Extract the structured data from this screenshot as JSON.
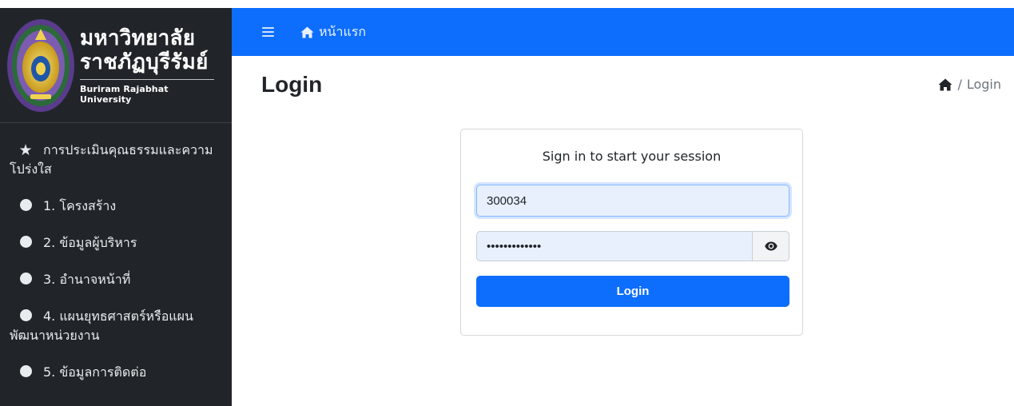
{
  "brand": {
    "name_line1": "มหาวิทยาลัย",
    "name_line2": "ราชภัฏบุรีรัมย์",
    "name_en": "Buriram Rajabhat University",
    "logo_icon": "university-seal"
  },
  "sidebar": {
    "items": [
      {
        "label": "การประเมินคุณธรรมและความโปร่งใส",
        "icon": "star-icon"
      },
      {
        "label": "1. โครงสร้าง",
        "icon": "circle-icon"
      },
      {
        "label": "2. ข้อมูลผู้บริหาร",
        "icon": "circle-icon"
      },
      {
        "label": "3. อำนาจหน้าที่",
        "icon": "circle-icon"
      },
      {
        "label": "4. แผนยุทธศาสตร์หรือแผนพัฒนาหน่วยงาน",
        "icon": "circle-icon"
      },
      {
        "label": "5. ข้อมูลการติดต่อ",
        "icon": "circle-icon"
      }
    ]
  },
  "topbar": {
    "home_label": "หน้าแรก",
    "color": "#0d6efd"
  },
  "page": {
    "title": "Login",
    "breadcrumb_current": "Login",
    "breadcrumb_separator": "/"
  },
  "login": {
    "message": "Sign in to start your session",
    "username_value": "300034",
    "password_value": "•••••••••••••",
    "submit_label": "Login"
  }
}
